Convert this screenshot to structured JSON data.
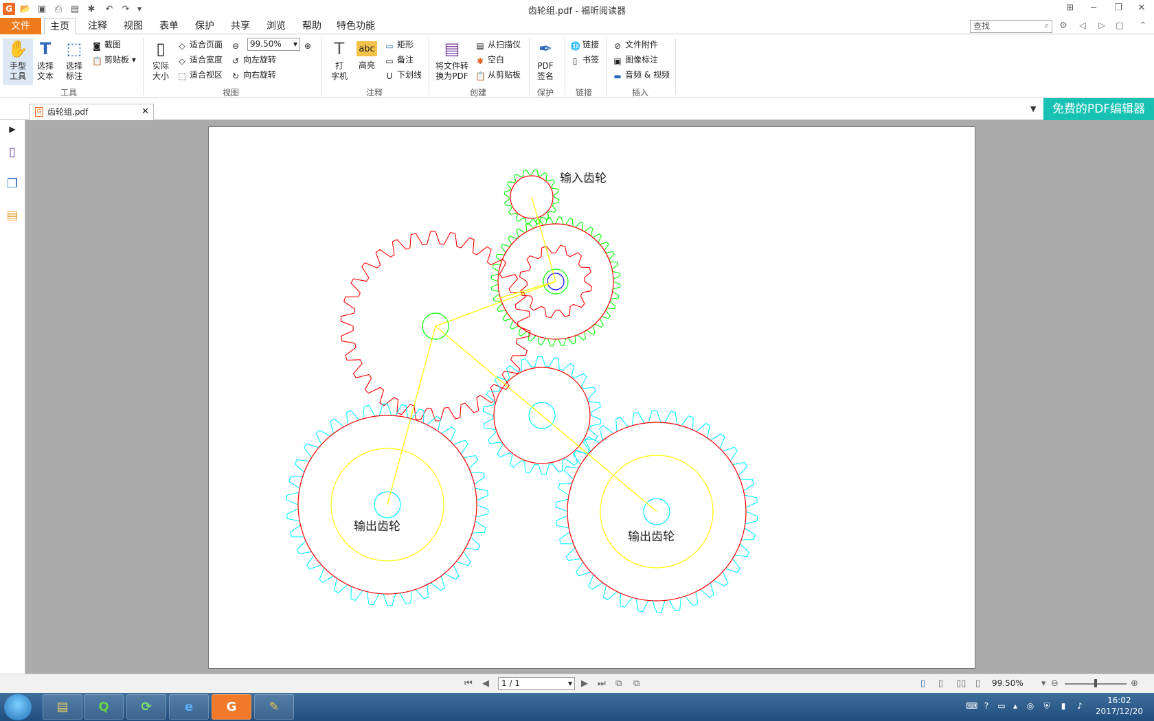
{
  "window": {
    "title": "齿轮组.pdf - 福昕阅读器"
  },
  "menu": {
    "tabs": [
      "文件",
      "主页",
      "注释",
      "视图",
      "表单",
      "保护",
      "共享",
      "浏览",
      "帮助",
      "特色功能"
    ],
    "search_placeholder": "查找"
  },
  "ribbon": {
    "hand_tool": "手型\n工具",
    "select_text": "选择\n文本",
    "select_annot": "选择\n标注",
    "screenshot": "截图",
    "clipboard": "剪贴板",
    "group_tools": "工具",
    "actual_size": "实际\n大小",
    "fit_page": "适合页面",
    "fit_width": "适合宽度",
    "fit_view": "适合视区",
    "zoom_value": "99.50%",
    "rotate_left": "向左旋转",
    "rotate_right": "向右旋转",
    "group_view": "视图",
    "typewriter": "打\n字机",
    "highlight": "高亮",
    "rect": "矩形",
    "note": "备注",
    "underline": "下划线",
    "group_annot": "注释",
    "convert_pdf": "将文件转\n换为PDF",
    "from_scanner": "从扫描仪",
    "blank": "空白",
    "from_clipboard": "从剪贴板",
    "group_create": "创建",
    "pdf_sign": "PDF\n签名",
    "group_protect": "保护",
    "link": "链接",
    "bookmark": "书签",
    "group_link": "链接",
    "file_attach": "文件附件",
    "image_annot": "图像标注",
    "audio_video": "音频 & 视频",
    "group_insert": "插入"
  },
  "document": {
    "tab_name": "齿轮组.pdf",
    "promo": "免费的PDF编辑器",
    "labels": {
      "input_gear": "输入齿轮",
      "output_gear_left": "输出齿轮",
      "output_gear_right": "输出齿轮"
    }
  },
  "status": {
    "page": "1 / 1",
    "zoom": "99.50%"
  },
  "taskbar": {
    "time": "16:02",
    "date": "2017/12/20"
  },
  "colors": {
    "accent": "#ef7a1a",
    "promo": "#17c2b3",
    "gear_red": "#ff0000",
    "gear_green": "#00ff00",
    "gear_cyan": "#00ffff",
    "gear_yellow": "#ffff00",
    "gear_blue": "#0000ff"
  }
}
